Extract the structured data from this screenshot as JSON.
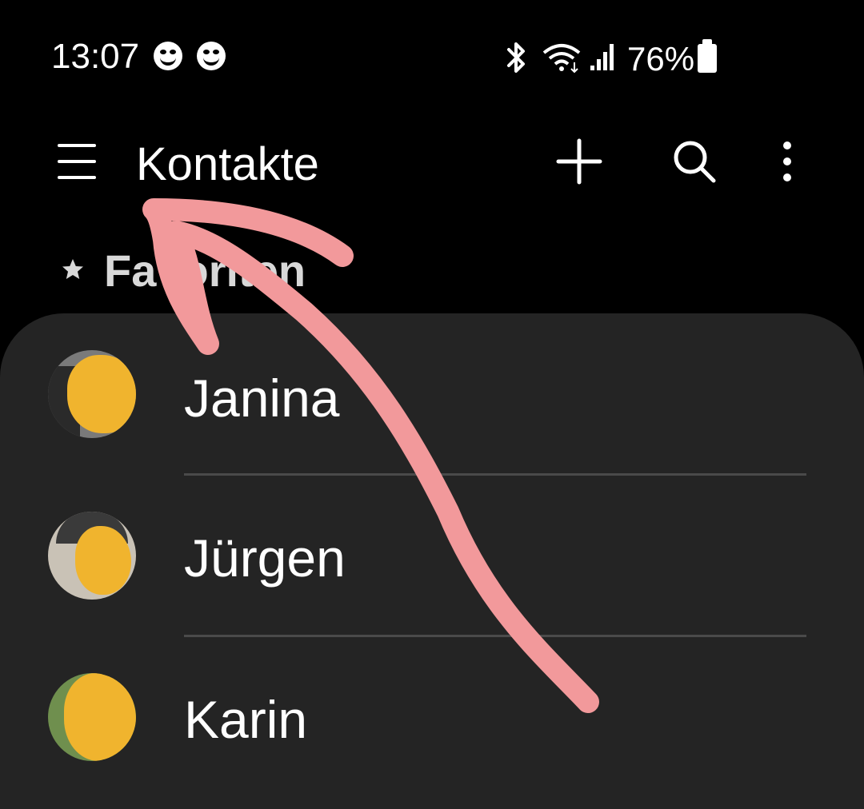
{
  "status_bar": {
    "time": "13:07",
    "icons": [
      "smiley-icon",
      "smiley-icon",
      "bluetooth-icon",
      "wifi-icon",
      "signal-icon",
      "battery-icon"
    ],
    "battery": "76%"
  },
  "app_bar": {
    "title": "Kontakte",
    "icons": [
      "menu-icon",
      "add-icon",
      "search-icon",
      "more-vert-icon"
    ]
  },
  "favorites": {
    "label": "Favoriten",
    "contacts": [
      {
        "name": "Janina"
      },
      {
        "name": "Jürgen"
      },
      {
        "name": "Karin"
      }
    ]
  },
  "colors": {
    "background": "#000000",
    "card": "#242424",
    "annotation": "#f2999b",
    "avatar_redaction": "#f0b42e"
  }
}
